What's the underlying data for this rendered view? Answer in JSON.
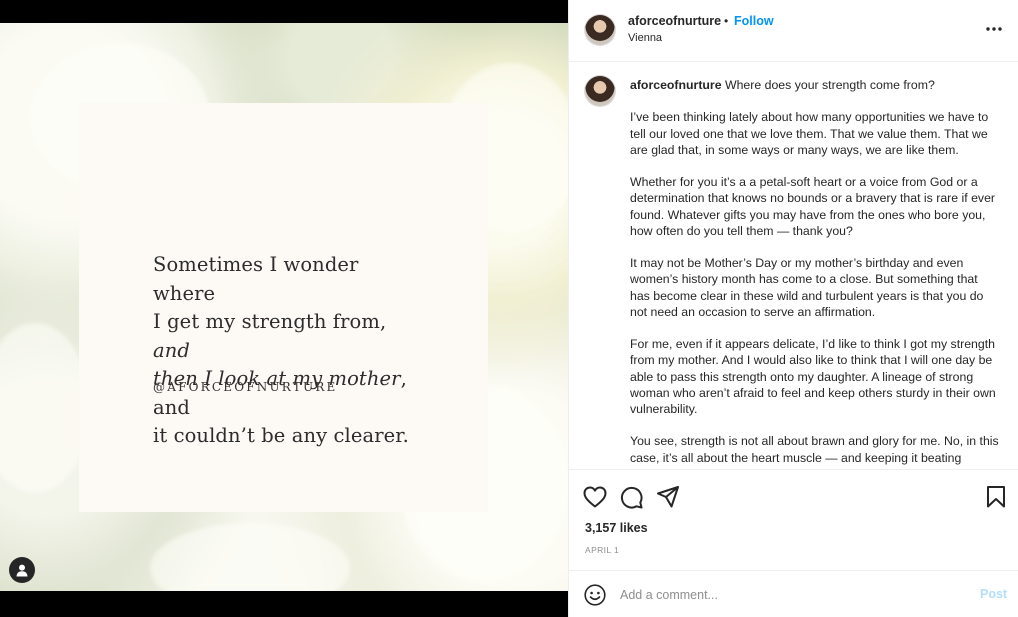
{
  "media": {
    "quote_lines": [
      {
        "text": "Sometimes I wonder where",
        "italic": ""
      },
      {
        "text": "I get my strength from, ",
        "italic": "and"
      },
      {
        "text": "",
        "italic": "then I look at my mother",
        "after": ", and"
      },
      {
        "text": "it couldn’t be any clearer.",
        "italic": ""
      }
    ],
    "handle": "@AFORCEOFNURTURE"
  },
  "header": {
    "username": "aforceofnurture",
    "separator": "•",
    "follow_label": "Follow",
    "location": "Vienna"
  },
  "caption": {
    "username": "aforceofnurture",
    "first_line": "Where does your strength come from?",
    "paragraphs": [
      "I’ve been thinking lately about how many opportunities we have to tell our loved one that we love them. That we value them. That we are glad that, in some ways or many ways, we are like them.",
      "Whether for you it’s a a petal-soft heart or a voice from God or a determination that knows no bounds or a bravery that is rare if ever found. Whatever gifts you may have from the ones who bore you, how often do you tell them — thank you?",
      "It may not be Mother’s Day or my mother’s birthday and even women’s history month has come to a close. But something that has become clear in these wild and turbulent years is that you do not need an occasion to serve an affirmation.",
      "For me, even if it appears delicate, I’d like to think I got my strength from my mother. And I would also like to think that I will one day be able to pass this strength onto my daughter. A lineage of strong woman who aren’t afraid to feel and keep others sturdy in their own vulnerability.",
      "You see, strength is not all about brawn and glory for me. No, in this case, it’s all about the heart muscle — and keeping it beating"
    ]
  },
  "actions": {
    "likes": "3,157 likes",
    "date": "APRIL 1",
    "icons": [
      "heart-icon",
      "comment-icon",
      "share-icon",
      "bookmark-icon"
    ]
  },
  "comment": {
    "placeholder": "Add a comment...",
    "post_label": "Post"
  },
  "colors": {
    "accent": "#0095f6",
    "post_disabled": "#b2dffc",
    "muted": "#8e8e8e"
  }
}
